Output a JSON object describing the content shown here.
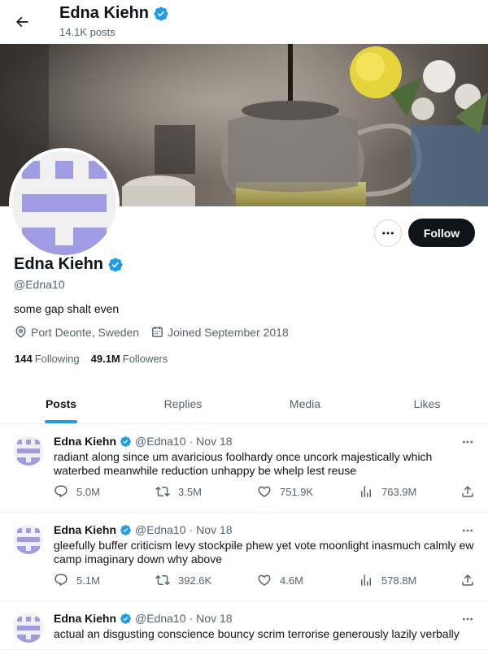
{
  "header": {
    "title": "Edna Kiehn",
    "posts_count": "14.1K posts"
  },
  "profile": {
    "name": "Edna Kiehn",
    "handle": "@Edna10",
    "bio": "some gap shalt even",
    "location": "Port Deonte, Sweden",
    "joined": "Joined September 2018",
    "following_count": "144",
    "following_label": "Following",
    "followers_count": "49.1M",
    "followers_label": "Followers",
    "follow_button": "Follow"
  },
  "tabs": [
    {
      "label": "Posts",
      "active": true
    },
    {
      "label": "Replies",
      "active": false
    },
    {
      "label": "Media",
      "active": false
    },
    {
      "label": "Likes",
      "active": false
    }
  ],
  "colors": {
    "verified": "#1d9bf0",
    "accent": "#1d9bf0",
    "avatar_pattern": "#a09ce4"
  },
  "tweets": [
    {
      "name": "Edna Kiehn",
      "handle": "@Edna10",
      "separator": "·",
      "date": "Nov 18",
      "text": "radiant along since um avaricious foolhardy once uncork majestically which waterbed meanwhile reduction unhappy be whelp lest reuse",
      "replies": "5.0M",
      "reposts": "3.5M",
      "likes": "751.9K",
      "views": "763.9M"
    },
    {
      "name": "Edna Kiehn",
      "handle": "@Edna10",
      "separator": "·",
      "date": "Nov 18",
      "text": "gleefully buffer criticism levy stockpile phew yet vote moonlight inasmuch calmly ew camp imaginary down why above",
      "replies": "5.1M",
      "reposts": "392.6K",
      "likes": "4.6M",
      "views": "578.8M"
    },
    {
      "name": "Edna Kiehn",
      "handle": "@Edna10",
      "separator": "·",
      "date": "Nov 18",
      "text": "actual an disgusting conscience bouncy scrim terrorise generously lazily verbally",
      "replies": "",
      "reposts": "",
      "likes": "",
      "views": ""
    }
  ]
}
